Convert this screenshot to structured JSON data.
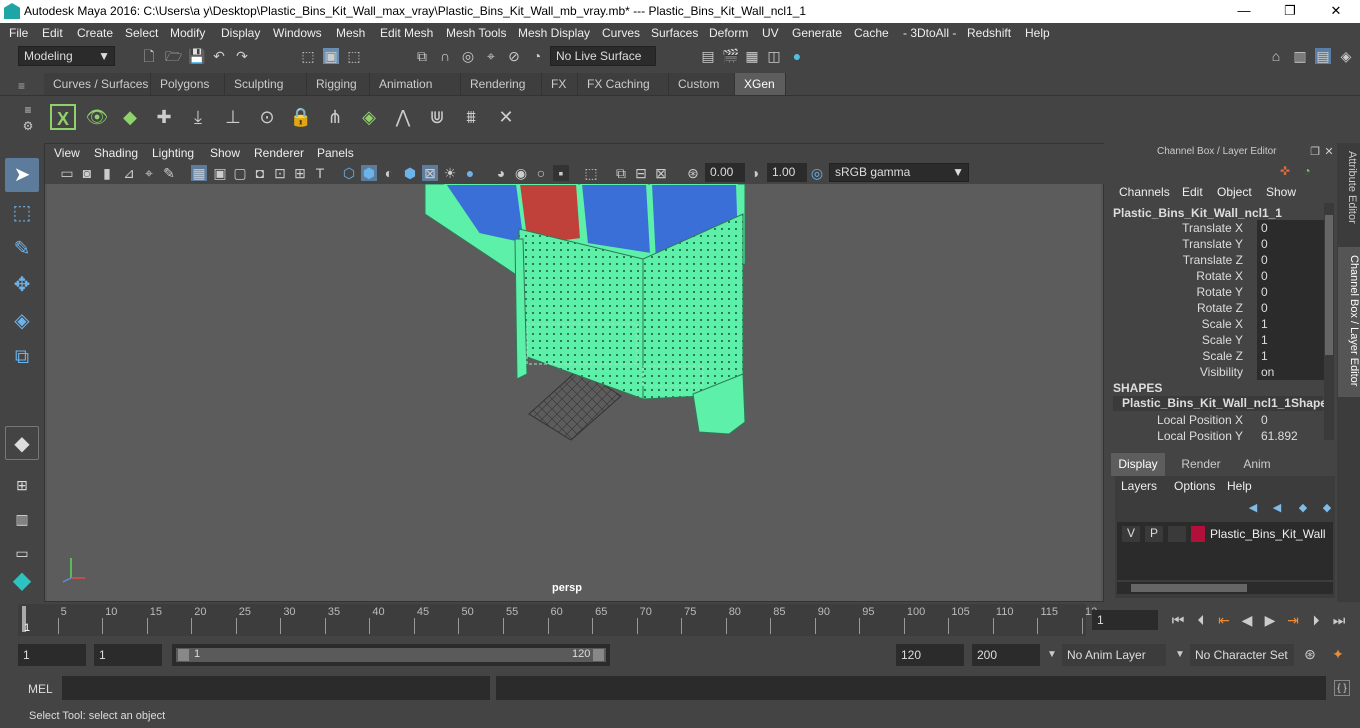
{
  "title": "Autodesk Maya 2016: C:\\Users\\a y\\Desktop\\Plastic_Bins_Kit_Wall_max_vray\\Plastic_Bins_Kit_Wall_mb_vray.mb*   ---   Plastic_Bins_Kit_Wall_ncl1_1",
  "window": {
    "minimize": "—",
    "maximize": "❐",
    "close": "✕"
  },
  "menu": [
    "File",
    "Edit",
    "Create",
    "Select",
    "Modify",
    "Display",
    "Windows",
    "Mesh",
    "Edit Mesh",
    "Mesh Tools",
    "Mesh Display",
    "Curves",
    "Surfaces",
    "Deform",
    "UV",
    "Generate",
    "Cache",
    "- 3DtoAll -",
    "Redshift",
    "Help"
  ],
  "status": {
    "mode": "Modeling",
    "live_surface": "No Live Surface"
  },
  "shelf_tabs": [
    "Curves / Surfaces",
    "Polygons",
    "Sculpting",
    "Rigging",
    "Animation",
    "Rendering",
    "FX",
    "FX Caching",
    "Custom",
    "XGen"
  ],
  "shelf_active": "XGen",
  "panel_menu": [
    "View",
    "Shading",
    "Lighting",
    "Show",
    "Renderer",
    "Panels"
  ],
  "panel_fields": {
    "exposure": "0.00",
    "gamma": "1.00",
    "colorspace": "sRGB gamma"
  },
  "viewport": {
    "camera": "persp",
    "mesh_color": "#5cf0a8",
    "bin_blue": "#3a6fd8",
    "bin_red": "#c0403a"
  },
  "channel_box": {
    "header": "Channel Box / Layer Editor",
    "menu": [
      "Channels",
      "Edit",
      "Object",
      "Show"
    ],
    "object": "Plastic_Bins_Kit_Wall_ncl1_1",
    "channels": [
      {
        "label": "Translate X",
        "value": "0"
      },
      {
        "label": "Translate Y",
        "value": "0"
      },
      {
        "label": "Translate Z",
        "value": "0"
      },
      {
        "label": "Rotate X",
        "value": "0"
      },
      {
        "label": "Rotate Y",
        "value": "0"
      },
      {
        "label": "Rotate Z",
        "value": "0"
      },
      {
        "label": "Scale X",
        "value": "1"
      },
      {
        "label": "Scale Y",
        "value": "1"
      },
      {
        "label": "Scale Z",
        "value": "1"
      },
      {
        "label": "Visibility",
        "value": "on"
      }
    ],
    "shapes_header": "SHAPES",
    "shape_name": "Plastic_Bins_Kit_Wall_ncl1_1Shape",
    "shape_channels": [
      {
        "label": "Local Position X",
        "value": "0"
      },
      {
        "label": "Local Position Y",
        "value": "61.892"
      }
    ]
  },
  "layer_editor": {
    "tabs": [
      "Display",
      "Render",
      "Anim"
    ],
    "active_tab": "Display",
    "menu": [
      "Layers",
      "Options",
      "Help"
    ],
    "layer": {
      "v": "V",
      "p": "P",
      "name": "Plastic_Bins_Kit_Wall",
      "color": "#b0103a"
    }
  },
  "side_tabs": [
    "Attribute Editor",
    "Channel Box / Layer Editor"
  ],
  "timeline": {
    "ticks": [
      "5",
      "10",
      "15",
      "20",
      "25",
      "30",
      "35",
      "40",
      "45",
      "50",
      "55",
      "60",
      "65",
      "70",
      "75",
      "80",
      "85",
      "90",
      "95",
      "100",
      "105",
      "110",
      "115",
      "12"
    ],
    "first": "1",
    "current_frame": "1",
    "tick_max": 120
  },
  "range": {
    "start": "1",
    "playback_start": "1",
    "slider_start": "1",
    "slider_end": "120",
    "playback_end": "120",
    "end": "200",
    "anim_layer": "No Anim Layer",
    "char_set": "No Character Set"
  },
  "command": {
    "label": "MEL"
  },
  "help_line": "Select Tool: select an object"
}
